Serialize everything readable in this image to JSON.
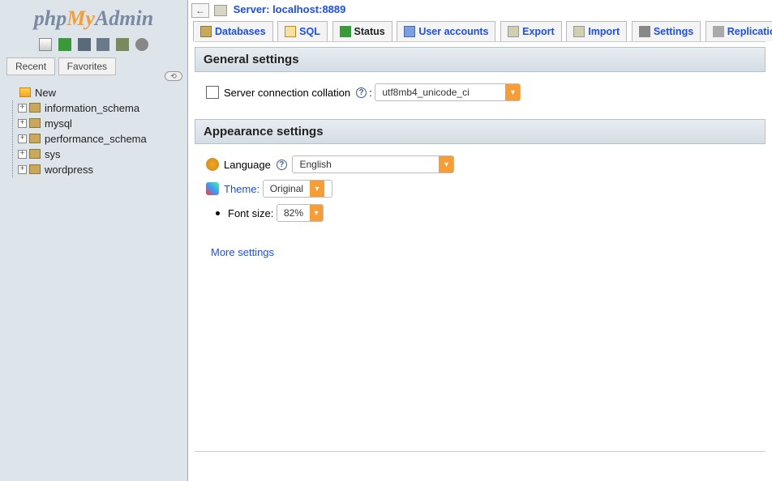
{
  "logo": {
    "p1": "php",
    "p2": "My",
    "p3": "Admin"
  },
  "sidebar": {
    "tabs": {
      "recent": "Recent",
      "favorites": "Favorites"
    },
    "new_label": "New",
    "databases": [
      "information_schema",
      "mysql",
      "performance_schema",
      "sys",
      "wordpress"
    ]
  },
  "server": {
    "prefix": "Server:",
    "host": "localhost:8889"
  },
  "nav": {
    "databases": "Databases",
    "sql": "SQL",
    "status": "Status",
    "users": "User accounts",
    "export": "Export",
    "import": "Import",
    "settings": "Settings",
    "replication": "Replication"
  },
  "sections": {
    "general": {
      "title": "General settings",
      "collation_label": "Server connection collation",
      "collation_value": "utf8mb4_unicode_ci"
    },
    "appearance": {
      "title": "Appearance settings",
      "language_label": "Language",
      "language_value": "English",
      "theme_label": "Theme:",
      "theme_value": "Original",
      "fontsize_label": "Font size:",
      "fontsize_value": "82%"
    },
    "more": "More settings"
  },
  "glyphs": {
    "colon": ":",
    "leftarrow": "←"
  }
}
